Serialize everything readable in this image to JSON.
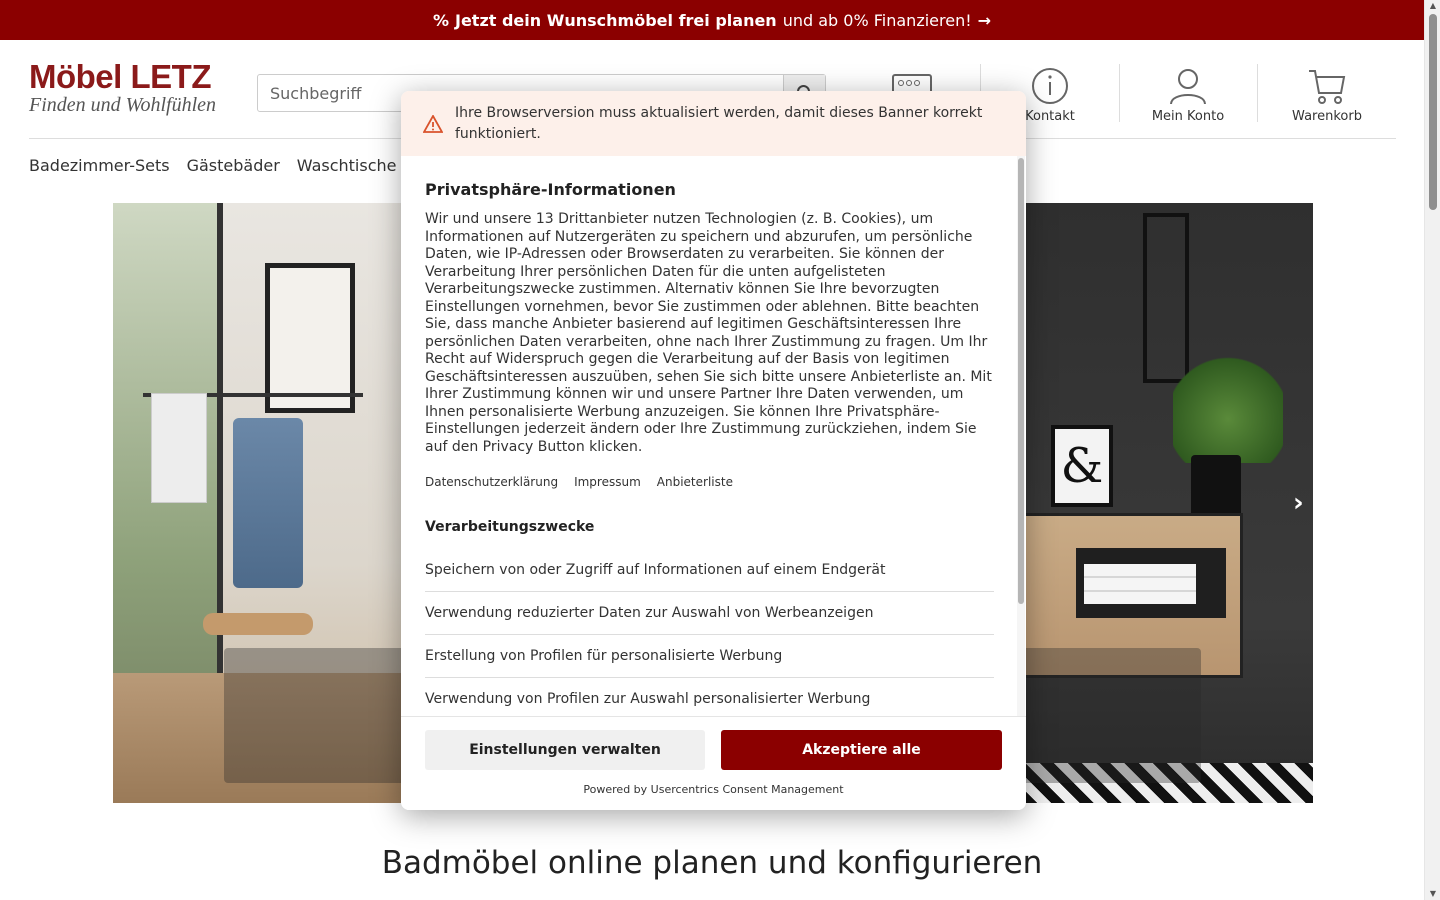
{
  "promo": {
    "icon": "percent-icon",
    "bold": "Jetzt dein Wunschmöbel frei planen",
    "text": "und ab 0% Finanzieren!",
    "arrow": "→"
  },
  "header": {
    "brand": "Möbel LETZ",
    "slogan": "Finden und Wohlfühlen",
    "search": {
      "placeholder": "Suchbegriff"
    },
    "actions": [
      {
        "label": "Kontakt",
        "icon": "info-icon"
      },
      {
        "label": "Mein Konto",
        "icon": "user-icon"
      },
      {
        "label": "Warenkorb",
        "icon": "cart-icon"
      }
    ]
  },
  "nav": {
    "items": [
      "Badezimmer-Sets",
      "Gästebäder",
      "Waschtische"
    ]
  },
  "hero": {
    "next": "›"
  },
  "headline": "Badmöbel online planen und konfigurieren",
  "consent": {
    "warning": "Ihre Browserversion muss aktualisiert werden, damit dieses Banner korrekt funktioniert.",
    "title": "Privatsphäre-Informationen",
    "description": "Wir und unsere 13 Drittanbieter nutzen Technologien (z. B. Cookies), um Informationen auf Nutzergeräten zu speichern und abzurufen, um persönliche Daten, wie IP-Adressen oder Browserdaten zu verarbeiten. Sie können der Verarbeitung Ihrer persönlichen Daten für die unten aufgelisteten Verarbeitungszwecke zustimmen. Alternativ können Sie Ihre bevorzugten Einstellungen vornehmen, bevor Sie zustimmen oder ablehnen. Bitte beachten Sie, dass manche Anbieter basierend auf legitimen Geschäftsinteressen Ihre persönlichen Daten verarbeiten, ohne nach Ihrer Zustimmung zu fragen. Um Ihr Recht auf Widerspruch gegen die Verarbeitung auf der Basis von legitimen Geschäftsinteressen auszuüben, sehen Sie sich bitte unsere Anbieterliste an. Mit Ihrer Zustimmung können wir und unsere Partner Ihre Daten verwenden, um Ihnen personalisierte Werbung anzuzeigen. Sie können Ihre Privatsphäre-Einstellungen jederzeit ändern oder Ihre Zustimmung zurückziehen, indem Sie auf den Privacy Button klicken.",
    "links": [
      "Datenschutzerklärung",
      "Impressum",
      "Anbieterliste"
    ],
    "purposes_title": "Verarbeitungszwecke",
    "purposes": [
      "Speichern von oder Zugriff auf Informationen auf einem Endgerät",
      "Verwendung reduzierter Daten zur Auswahl von Werbeanzeigen",
      "Erstellung von Profilen für personalisierte Werbung",
      "Verwendung von Profilen zur Auswahl personalisierter Werbung"
    ],
    "settings_button": "Einstellungen verwalten",
    "accept_button": "Akzeptiere alle",
    "powered_by": "Powered by Usercentrics Consent Management",
    "accent": "#8b0000"
  }
}
